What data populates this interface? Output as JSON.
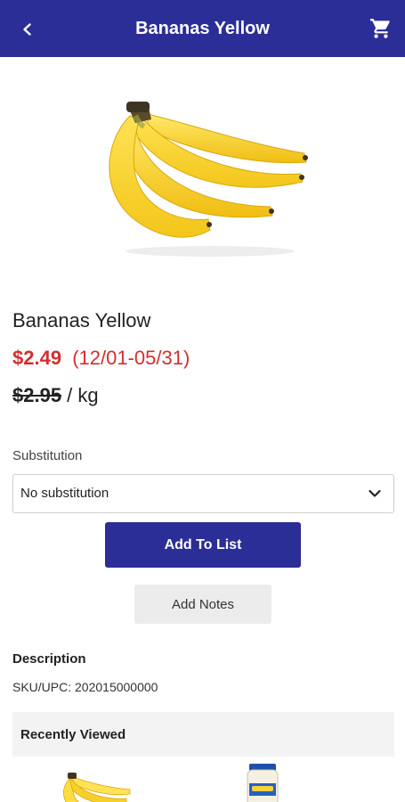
{
  "header": {
    "title": "Bananas Yellow",
    "back_icon": "chevron-left-icon",
    "cart_icon": "shopping-cart-icon",
    "background_color": "#2b2e96"
  },
  "product": {
    "name": "Bananas Yellow",
    "sale_price": "$2.49",
    "sale_dates": "(12/01-05/31)",
    "regular_price": "$2.95",
    "unit": " / kg",
    "sale_color": "#d32f2f"
  },
  "substitution": {
    "label": "Substitution",
    "selected": "No substitution"
  },
  "actions": {
    "add_to_list": "Add To List",
    "add_notes": "Add Notes"
  },
  "description": {
    "title": "Description",
    "sku": "SKU/UPC: 202015000000"
  },
  "recently_viewed": {
    "title": "Recently Viewed"
  }
}
